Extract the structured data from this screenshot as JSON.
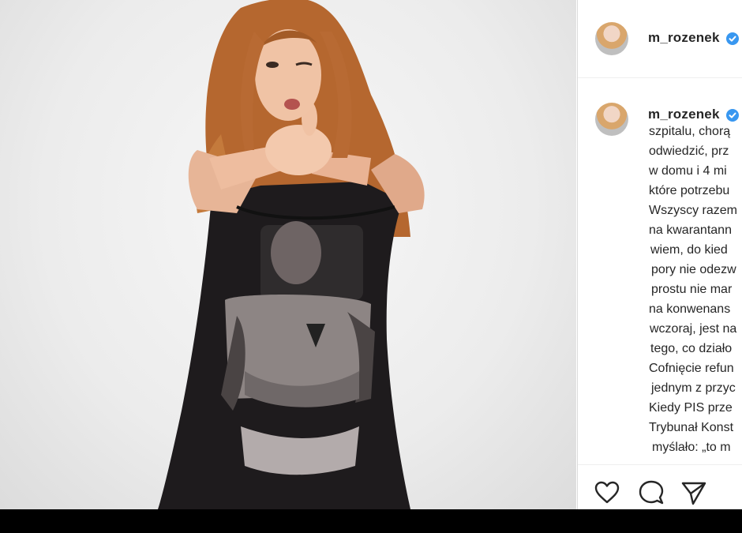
{
  "header": {
    "username": "m_rozenek",
    "verified": true
  },
  "caption": {
    "username": "m_rozenek",
    "lines": [
      "szpitalu, chorą",
      "odwiedzić, prz",
      "w domu i 4 mi",
      "które potrzebu",
      "Wszyscy razem",
      "na kwarantann",
      "wiem, do kied",
      "pory nie odezw",
      "prostu nie mar",
      "na konwenans",
      "wczoraj, jest na",
      "tego, co działo",
      "Cofnięcie refun",
      "jednym z przyc",
      "Kiedy PIS prze",
      "Trybunał Konst",
      "myślało: „to m"
    ]
  },
  "actions": {
    "like_icon": "heart-icon",
    "comment_icon": "comment-icon",
    "share_icon": "share-icon"
  },
  "colors": {
    "text": "#262626",
    "verified": "#3897f0",
    "border": "#dbdbdb"
  }
}
